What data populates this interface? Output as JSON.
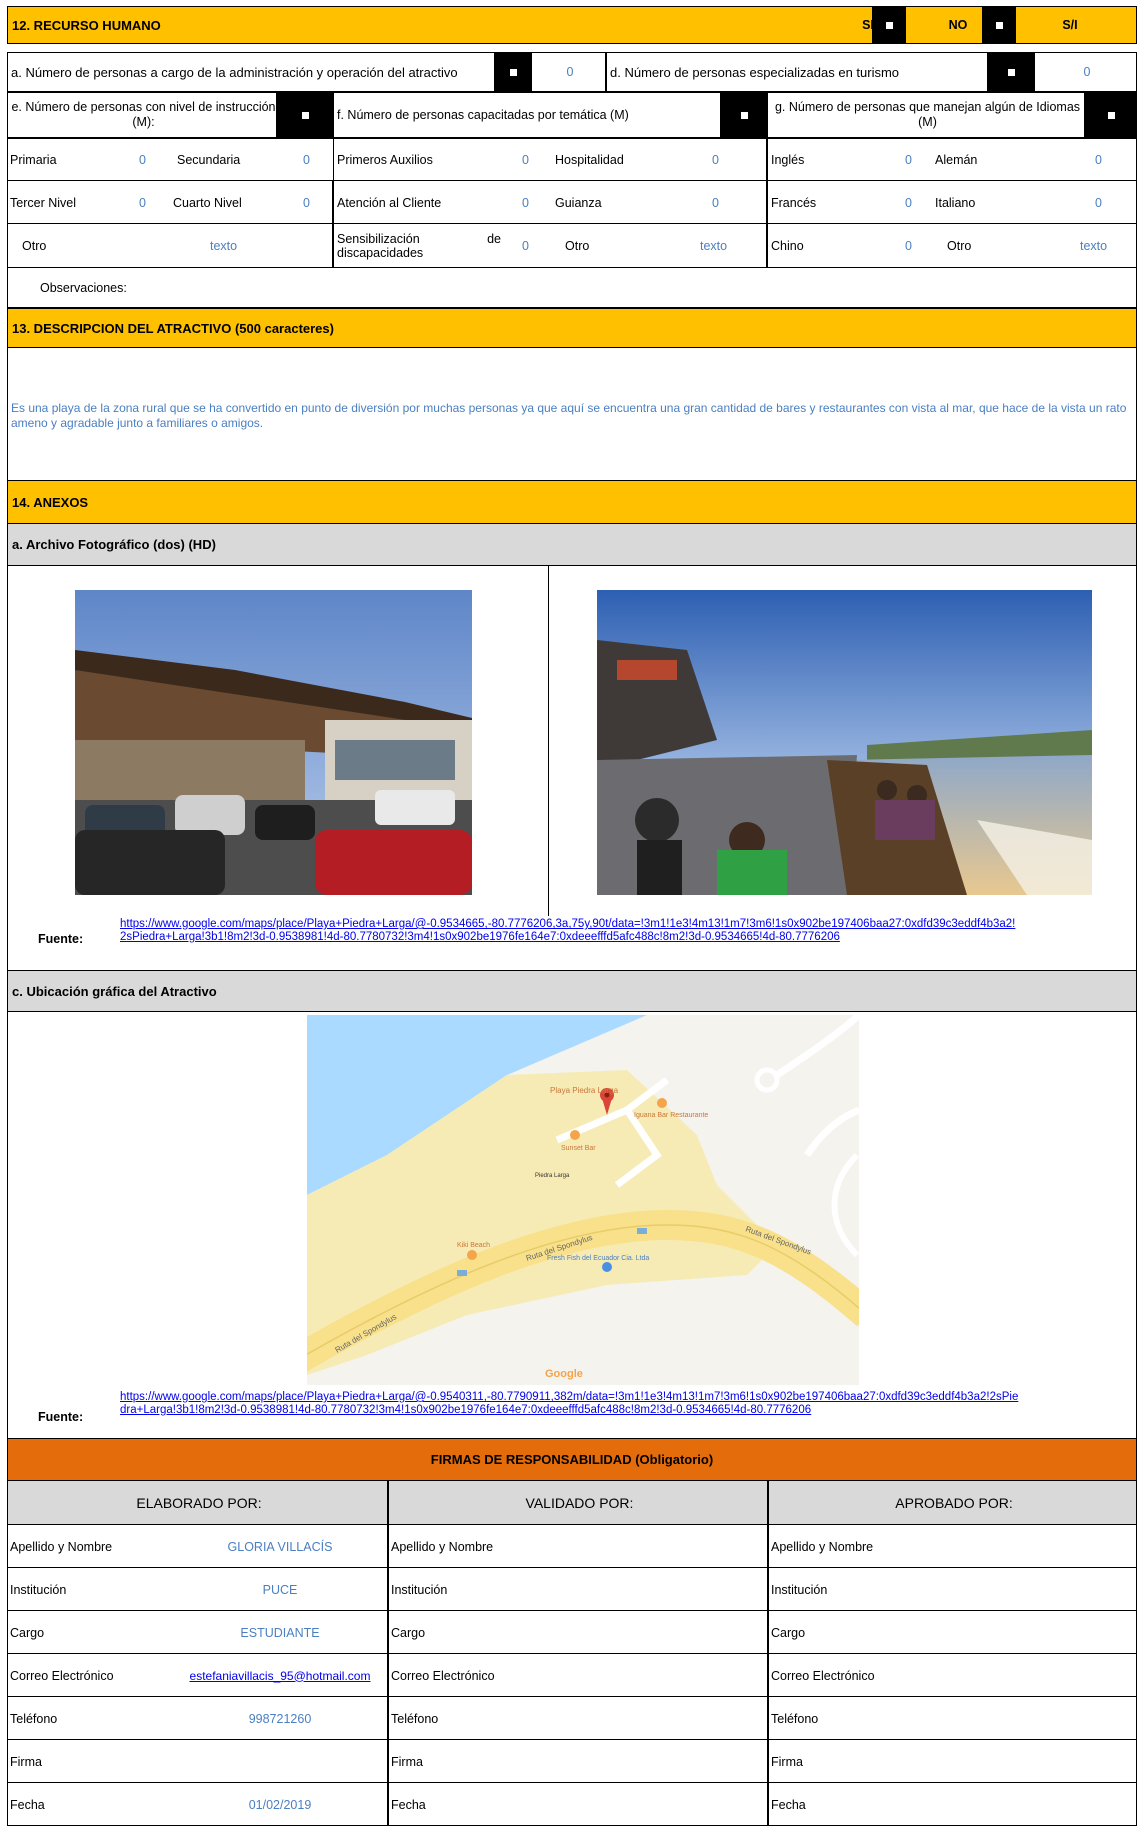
{
  "s12": {
    "title": "12. RECURSO HUMANO",
    "si": "SI",
    "no": "NO",
    "sn": "S/I",
    "a_label": "a. Número de personas a cargo de la administración y operación del atractivo",
    "a_value": "0",
    "d_label": "d. Número de personas especializadas en turismo",
    "d_value": "0",
    "e_label": "e. Número de personas con nivel de instrucción (M):",
    "f_label": "f. Número de personas capacitadas por temática (M)",
    "g_label": "g. Número de personas que manejan algún de Idiomas (M)",
    "rows": [
      {
        "c1": "Primaria",
        "v1": "0",
        "c2": "Secundaria",
        "v2": "0",
        "c3": "Primeros Auxilios",
        "v3": "0",
        "c4": "Hospitalidad",
        "v4": "0",
        "c5": "Inglés",
        "v5": "0",
        "c6": "Alemán",
        "v6": "0"
      },
      {
        "c1": "Tercer Nivel",
        "v1": "0",
        "c2": "Cuarto Nivel",
        "v2": "0",
        "c3": "Atención al Cliente",
        "v3": "0",
        "c4": "Guianza",
        "v4": "0",
        "c5": "Francés",
        "v5": "0",
        "c6": "Italiano",
        "v6": "0"
      },
      {
        "c1": "Otro",
        "v1": "texto",
        "c3": "Sensibilización de discapacidades",
        "v3": "0",
        "c4": "Otro",
        "v4": "texto",
        "c5": "Chino",
        "v5": "0",
        "c6": "Otro",
        "v6": "texto"
      }
    ],
    "observaciones": "Observaciones:"
  },
  "s13": {
    "title": "13. DESCRIPCION DEL ATRACTIVO (500 caracteres)",
    "text": "Es una playa de la zona rural que se ha convertido en punto de diversión por muchas personas ya que aquí se encuentra una gran cantidad de bares y restaurantes con vista al mar, que hace de la vista un rato ameno y agradable junto a familiares o amigos."
  },
  "s14": {
    "title": "14. ANEXOS",
    "photo_title": "a. Archivo Fotográfico (dos) (HD)",
    "fuente_label": "Fuente:",
    "fuente1": "https://www.google.com/maps/place/Playa+Piedra+Larga/@-0.9534665,-80.7776206,3a,75y,90t/data=!3m1!1e3!4m13!1m7!3m6!1s0x902be197406baa27:0xdfd39c3eddf4b3a2!2sPiedra+Larga!3b1!8m2!3d-0.9538981!4d-80.7780732!3m4!1s0x902be1976fe164e7:0xdeeefffd5afc488c!8m2!3d-0.9534665!4d-80.7776206",
    "map_title": "c. Ubicación gráfica del Atractivo",
    "fuente2": "https://www.google.com/maps/place/Playa+Piedra+Larga/@-0.9540311,-80.7790911,382m/data=!3m1!1e3!4m13!1m7!3m6!1s0x902be197406baa27:0xdfd39c3eddf4b3a2!2sPiedra+Larga!3b1!8m2!3d-0.9538981!4d-80.7780732!3m4!1s0x902be1976fe164e7:0xdeeefffd5afc488c!8m2!3d-0.9534665!4d-80.7776206",
    "map_labels": {
      "playa": "Playa Piedra Larga",
      "iguana": "Iguana Bar Restaurante",
      "sunset": "Sunset Bar",
      "piedra": "Piedra Larga",
      "kiki": "Kiki Beach",
      "fresh": "Fresh Fish del Ecuador Cia. Ltda",
      "ruta1": "Ruta del Spondylus",
      "ruta2": "Ruta del Spondylus",
      "ruta3": "Ruta del Spondylus",
      "google": "Google"
    }
  },
  "firmas": {
    "title": "FIRMAS DE RESPONSABILIDAD (Obligatorio)",
    "cols": [
      "ELABORADO POR:",
      "VALIDADO  POR:",
      "APROBADO POR:"
    ],
    "labels": [
      "Apellido y Nombre",
      "Institución",
      "Cargo",
      "Correo Electrónico",
      "Teléfono",
      "Firma",
      "Fecha"
    ],
    "values": [
      "GLORIA VILLACÍS",
      "PUCE",
      "ESTUDIANTE",
      "estefaniavillacis_95@hotmail.com",
      "998721260",
      "",
      "01/02/2019"
    ]
  }
}
